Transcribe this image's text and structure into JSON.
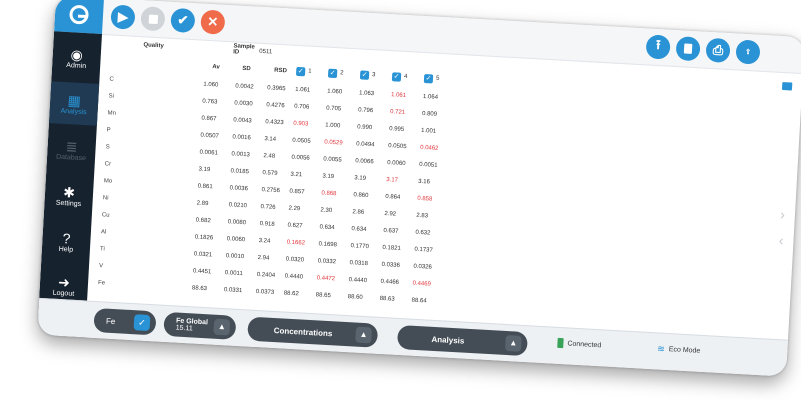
{
  "sidebar": {
    "items": [
      {
        "label": "Admin"
      },
      {
        "label": "Analysis"
      },
      {
        "label": "Database"
      },
      {
        "label": "Settings"
      },
      {
        "label": "Help"
      },
      {
        "label": "Logout"
      }
    ]
  },
  "header": {
    "quality_label": "Quality",
    "sample_label": "Sample ID",
    "sample_value": "0511"
  },
  "table": {
    "col_headers": [
      "Av",
      "SD",
      "RSD"
    ],
    "run_checks": [
      "1",
      "2",
      "3",
      "4",
      "5"
    ],
    "row_labels": [
      "C",
      "Si",
      "Mn",
      "P",
      "S",
      "Cr",
      "Mo",
      "Ni",
      "Cu",
      "Al",
      "Ti",
      "V",
      "Fe"
    ],
    "rows": [
      {
        "av": "1.060",
        "sd": "0.0042",
        "rsd": "0.3965",
        "runs": [
          "1.061",
          "1.060",
          "1.063",
          "1.061",
          "1.064"
        ],
        "red": [
          3
        ]
      },
      {
        "av": "0.763",
        "sd": "0.0030",
        "rsd": "0.4276",
        "runs": [
          "0.706",
          "0.705",
          "0.796",
          "0.721",
          "0.809"
        ],
        "red": [
          3
        ]
      },
      {
        "av": "0.867",
        "sd": "0.0043",
        "rsd": "0.4323",
        "runs": [
          "0.903",
          "1.000",
          "0.990",
          "0.995",
          "1.001"
        ],
        "red": [
          0
        ]
      },
      {
        "av": "0.0507",
        "sd": "0.0016",
        "rsd": "3.14",
        "runs": [
          "0.0505",
          "0.0529",
          "0.0494",
          "0.0505",
          "0.0462"
        ],
        "red": [
          1,
          4
        ]
      },
      {
        "av": "0.0061",
        "sd": "0.0013",
        "rsd": "2.48",
        "runs": [
          "0.0056",
          "0.0055",
          "0.0066",
          "0.0060",
          "0.0051"
        ],
        "red": []
      },
      {
        "av": "3.19",
        "sd": "0.0185",
        "rsd": "0.579",
        "runs": [
          "3.21",
          "3.19",
          "3.19",
          "3.17",
          "3.16"
        ],
        "red": [
          3
        ]
      },
      {
        "av": "0.861",
        "sd": "0.0036",
        "rsd": "0.2756",
        "runs": [
          "0.857",
          "0.868",
          "0.860",
          "0.864",
          "0.858"
        ],
        "red": [
          1,
          4
        ]
      },
      {
        "av": "2.89",
        "sd": "0.0210",
        "rsd": "0.726",
        "runs": [
          "2.29",
          "2.30",
          "2.86",
          "2.92",
          "2.83"
        ],
        "red": []
      },
      {
        "av": "0.682",
        "sd": "0.0080",
        "rsd": "0.918",
        "runs": [
          "0.627",
          "0.634",
          "0.634",
          "0.637",
          "0.632"
        ],
        "red": []
      },
      {
        "av": "0.1826",
        "sd": "0.0060",
        "rsd": "3.24",
        "runs": [
          "0.1662",
          "0.1698",
          "0.1770",
          "0.1821",
          "0.1737"
        ],
        "red": [
          0
        ]
      },
      {
        "av": "0.0321",
        "sd": "0.0010",
        "rsd": "2.94",
        "runs": [
          "0.0320",
          "0.0332",
          "0.0318",
          "0.0336",
          "0.0326"
        ],
        "red": []
      },
      {
        "av": "0.4451",
        "sd": "0.0011",
        "rsd": "0.2404",
        "runs": [
          "0.4440",
          "0.4472",
          "0.4440",
          "0.4466",
          "0.4469"
        ],
        "red": [
          1,
          4
        ]
      },
      {
        "av": "88.63",
        "sd": "0.0331",
        "rsd": "0.0373",
        "runs": [
          "88.62",
          "88.65",
          "88.60",
          "88.63",
          "88.64"
        ],
        "red": []
      }
    ]
  },
  "bottom": {
    "base_label": "Fe",
    "global_label": "Fe Global",
    "global_value": "15.11",
    "concentrations_label": "Concentrations",
    "analysis_label": "Analysis",
    "connected_label": "Connected",
    "eco_label": "Eco Mode"
  },
  "colors": {
    "accent": "#2a93d5",
    "alert": "#e0393e",
    "sidebar": "#16222e"
  }
}
